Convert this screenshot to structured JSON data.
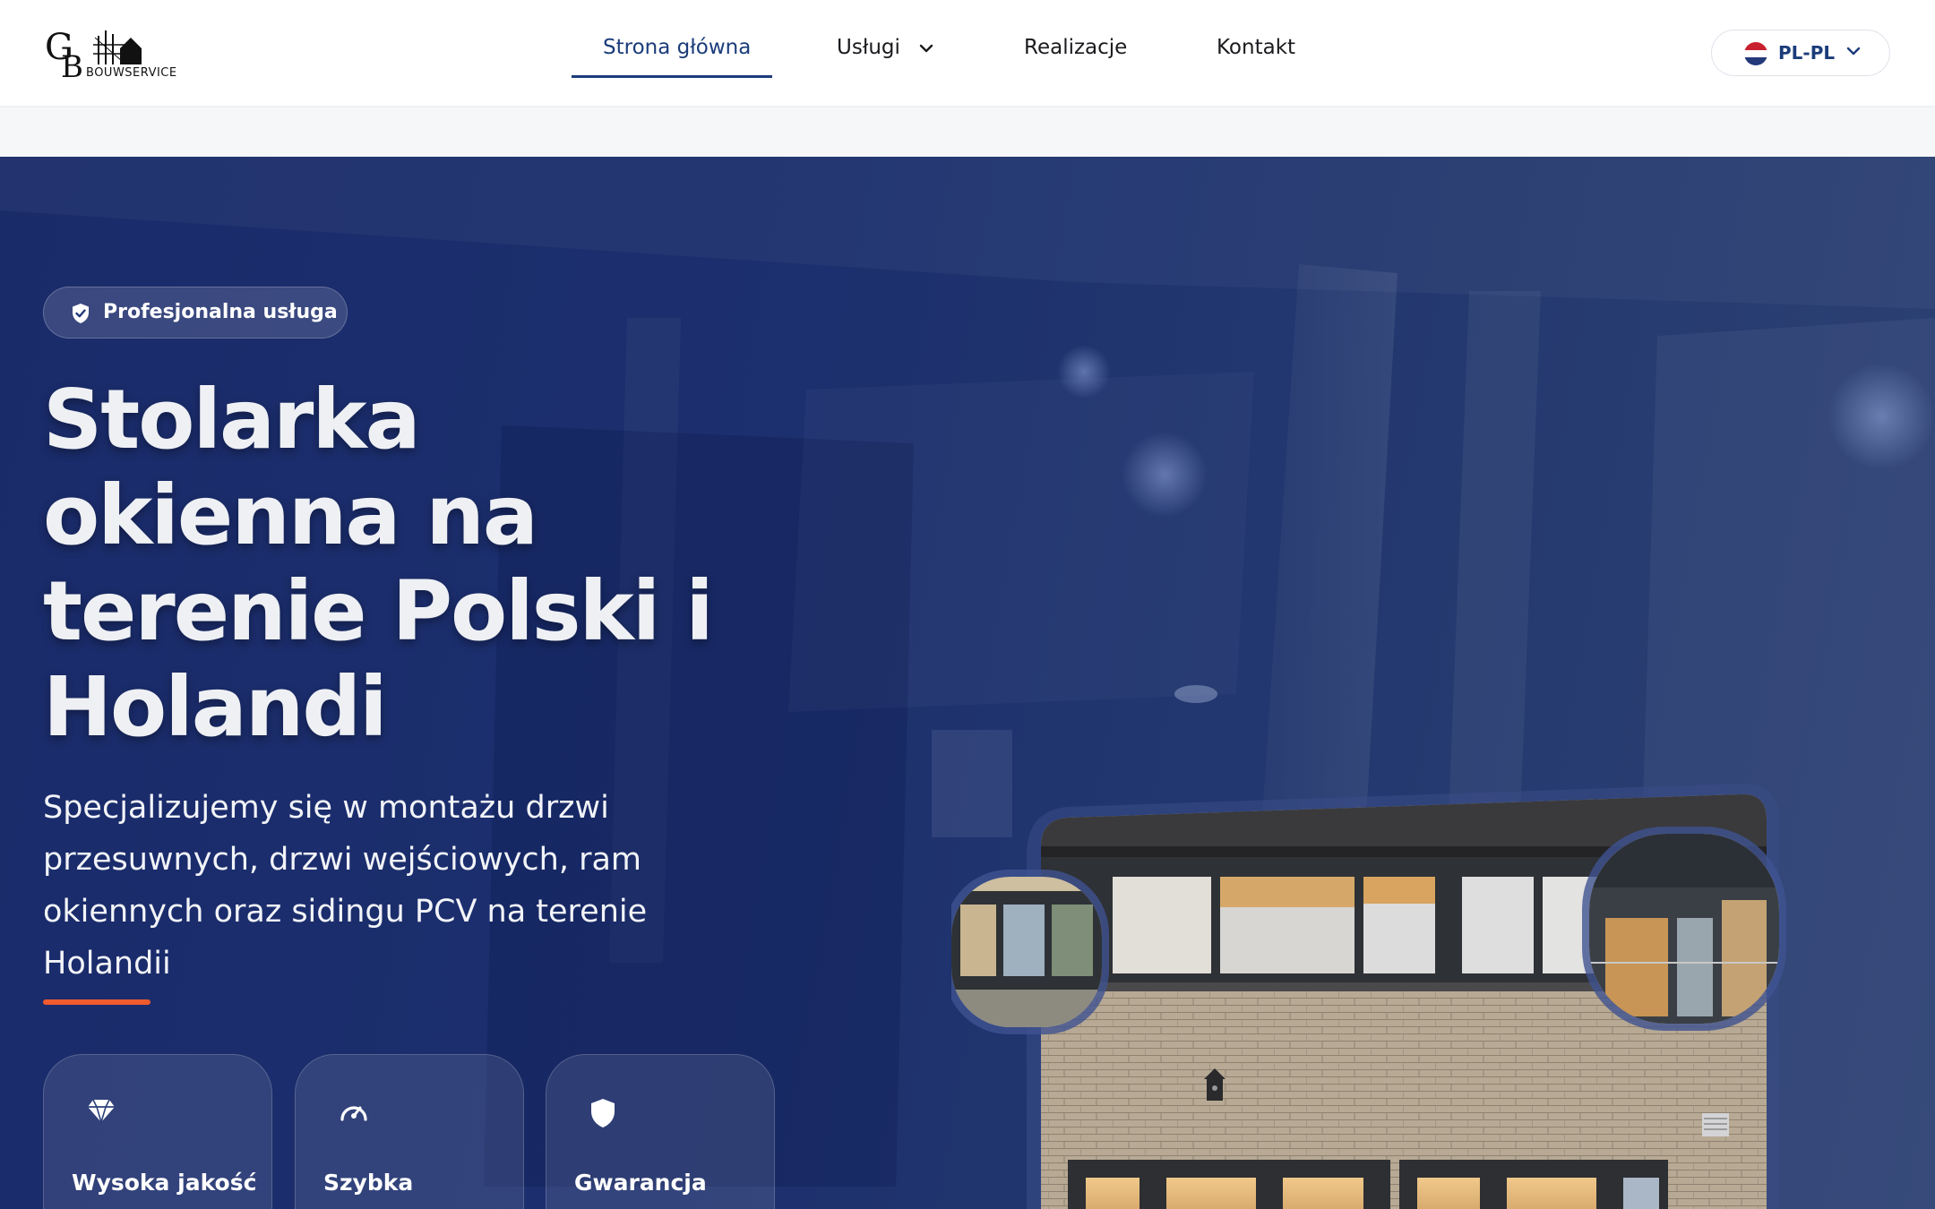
{
  "header": {
    "logo_text": "BOUWSERVICE",
    "nav": [
      {
        "label": "Strona główna",
        "active": true
      },
      {
        "label": "Usługi",
        "has_dropdown": true
      },
      {
        "label": "Realizacje"
      },
      {
        "label": "Kontakt"
      }
    ],
    "language": {
      "label": "PL-PL",
      "flag_icon": "netherlands-flag-icon"
    }
  },
  "hero": {
    "badge": {
      "icon": "shield-check-icon",
      "label": "Profesjonalna usługa"
    },
    "title": "Stolarka okienna na terenie Polski i Holandi",
    "subtitle": "Specjalizujemy się w montażu drzwi przesuwnych, drzwi wejściowych, ram okiennych oraz sidingu PCV na terenie Holandii",
    "features": [
      {
        "icon": "diamond-icon",
        "label": "Wysoka jakość"
      },
      {
        "icon": "speedometer-icon",
        "label": "Szybka"
      },
      {
        "icon": "shield-icon",
        "label": "Gwarancja"
      }
    ]
  },
  "colors": {
    "brand_blue": "#1b3c7a",
    "hero_background": "#1c2f6e",
    "accent_orange": "#ef5a2f"
  }
}
